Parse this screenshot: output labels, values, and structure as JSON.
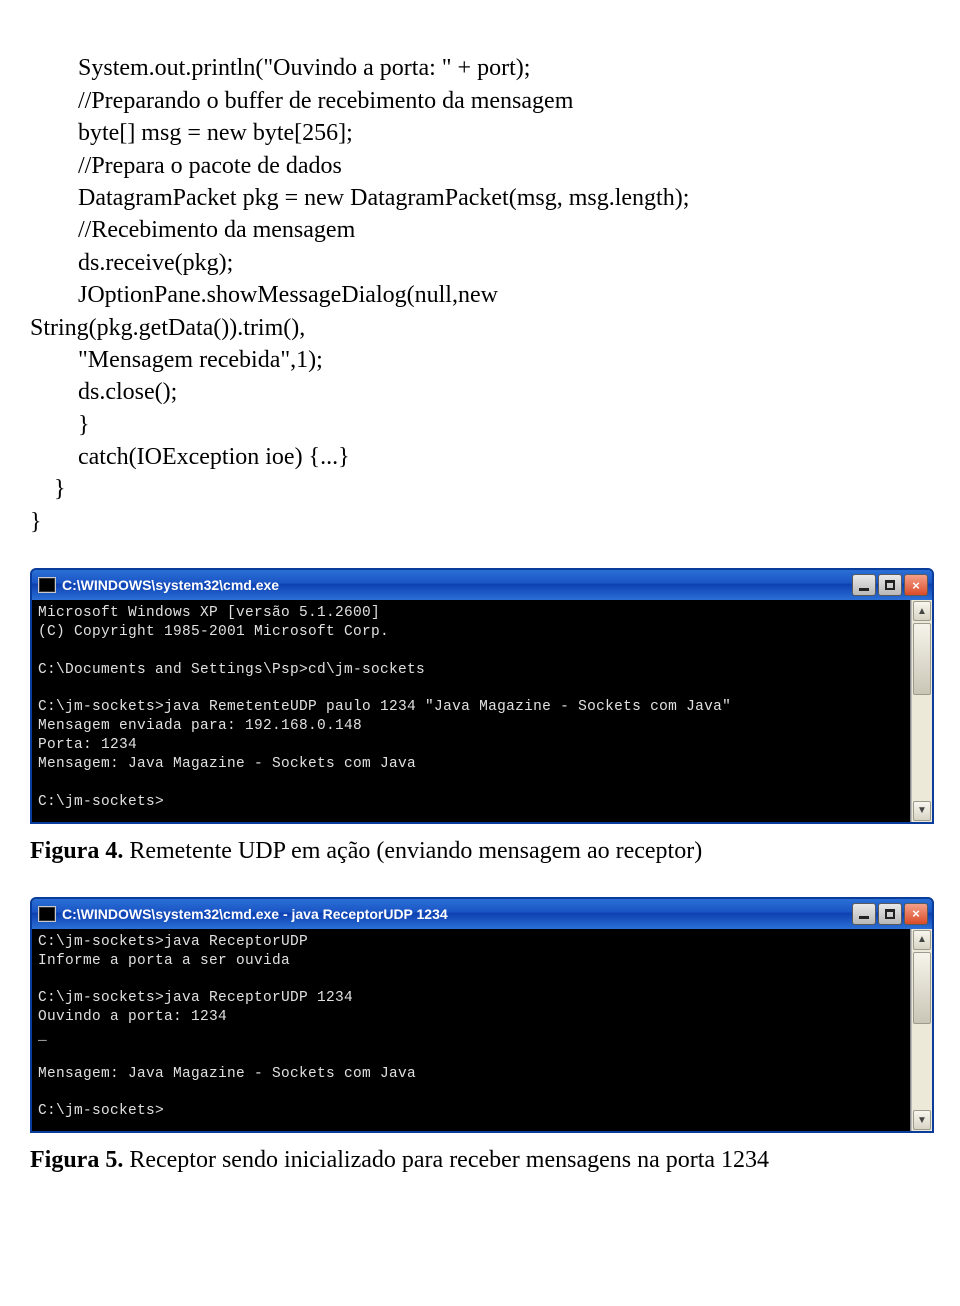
{
  "code": {
    "l1": "        System.out.println(\"Ouvindo a porta: \" + port);",
    "l2": "        //Preparando o buffer de recebimento da mensagem",
    "l3": "        byte[] msg = new byte[256];",
    "l4": "        //Prepara o pacote de dados",
    "l5": "        DatagramPacket pkg = new DatagramPacket(msg, msg.length);",
    "l6": "        //Recebimento da mensagem",
    "l7": "        ds.receive(pkg);",
    "l8": "        JOptionPane.showMessageDialog(null,new",
    "l9": "String(pkg.getData()).trim(),",
    "l10": "        \"Mensagem recebida\",1);",
    "l11": "        ds.close();",
    "l12": "        }",
    "l13": "        catch(IOException ioe) {...}",
    "l14": "    }",
    "l15": "}"
  },
  "screenshot1": {
    "title": "C:\\WINDOWS\\system32\\cmd.exe",
    "term_l1": "Microsoft Windows XP [versão 5.1.2600]",
    "term_l2": "(C) Copyright 1985-2001 Microsoft Corp.",
    "term_l3": "",
    "term_l4": "C:\\Documents and Settings\\Psp>cd\\jm-sockets",
    "term_l5": "",
    "term_l6": "C:\\jm-sockets>java RemetenteUDP paulo 1234 \"Java Magazine - Sockets com Java\"",
    "term_l7": "Mensagem enviada para: 192.168.0.148",
    "term_l8": "Porta: 1234",
    "term_l9": "Mensagem: Java Magazine - Sockets com Java",
    "term_l10": "",
    "term_l11": "C:\\jm-sockets>"
  },
  "caption1": {
    "bold": "Figura 4.",
    "rest": " Remetente UDP em ação (enviando mensagem ao receptor)"
  },
  "screenshot2": {
    "title": "C:\\WINDOWS\\system32\\cmd.exe - java ReceptorUDP 1234",
    "term_l1": "C:\\jm-sockets>java ReceptorUDP",
    "term_l2": "Informe a porta a ser ouvida",
    "term_l3": "",
    "term_l4": "C:\\jm-sockets>java ReceptorUDP 1234",
    "term_l5": "Ouvindo a porta: 1234",
    "term_l6": "_",
    "term_l7": "",
    "term_l8": "Mensagem: Java Magazine - Sockets com Java",
    "term_l9": "",
    "term_l10": "C:\\jm-sockets>"
  },
  "caption2": {
    "bold": "Figura 5.",
    "rest": " Receptor sendo inicializado para receber mensagens na porta 1234"
  },
  "buttons": {
    "close_glyph": "×"
  },
  "scroll_arrows": {
    "up": "▲",
    "down": "▼"
  }
}
